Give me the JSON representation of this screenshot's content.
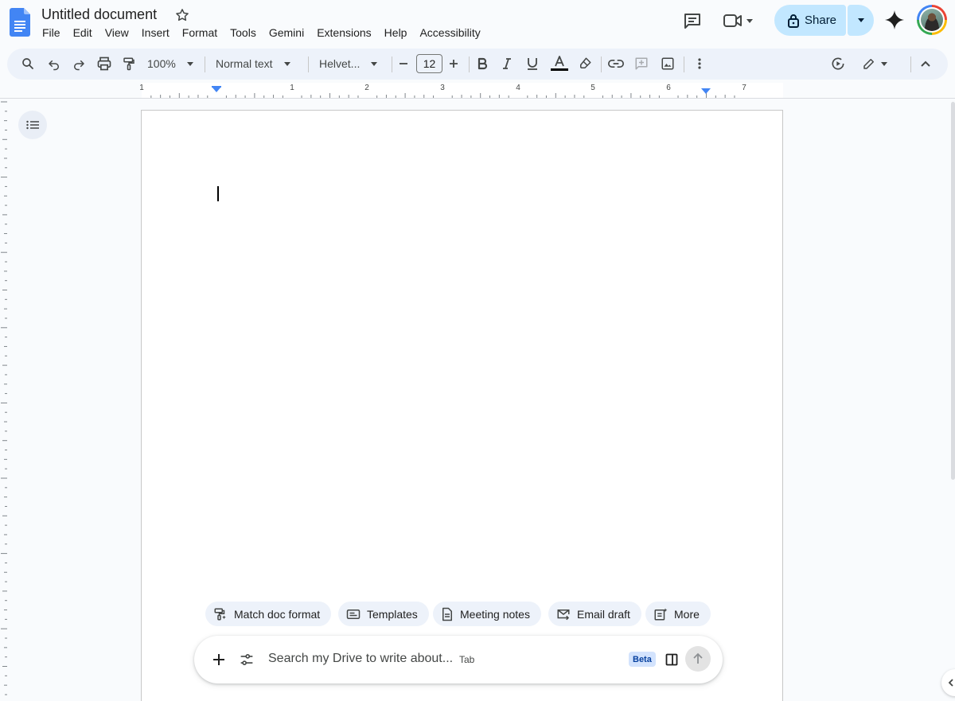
{
  "document": {
    "title": "Untitled document"
  },
  "menu": {
    "items": [
      {
        "label": "File"
      },
      {
        "label": "Edit"
      },
      {
        "label": "View"
      },
      {
        "label": "Insert"
      },
      {
        "label": "Format"
      },
      {
        "label": "Tools"
      },
      {
        "label": "Gemini"
      },
      {
        "label": "Extensions"
      },
      {
        "label": "Help"
      },
      {
        "label": "Accessibility"
      }
    ]
  },
  "header": {
    "share_label": "Share"
  },
  "toolbar": {
    "zoom": "100%",
    "style": "Normal text",
    "font": "Helvet...",
    "font_size": "12",
    "text_color": "#000000"
  },
  "ruler": {
    "labels": [
      "1",
      "1",
      "2",
      "3",
      "4",
      "5",
      "6",
      "7"
    ]
  },
  "chips": [
    {
      "label": "Match doc format",
      "icon": "match-format-icon"
    },
    {
      "label": "Templates",
      "icon": "templates-icon"
    },
    {
      "label": "Meeting notes",
      "icon": "document-icon"
    },
    {
      "label": "Email draft",
      "icon": "email-icon"
    },
    {
      "label": "More",
      "icon": "more-icon"
    }
  ],
  "prompt": {
    "placeholder": "Search my Drive to write about...",
    "tab_hint": "Tab",
    "beta": "Beta"
  },
  "colors": {
    "accent": "#0b57d0",
    "share_bg": "#c2e7ff",
    "toolbar_bg": "#edf2fa",
    "docs_blue": "#4285f4"
  }
}
